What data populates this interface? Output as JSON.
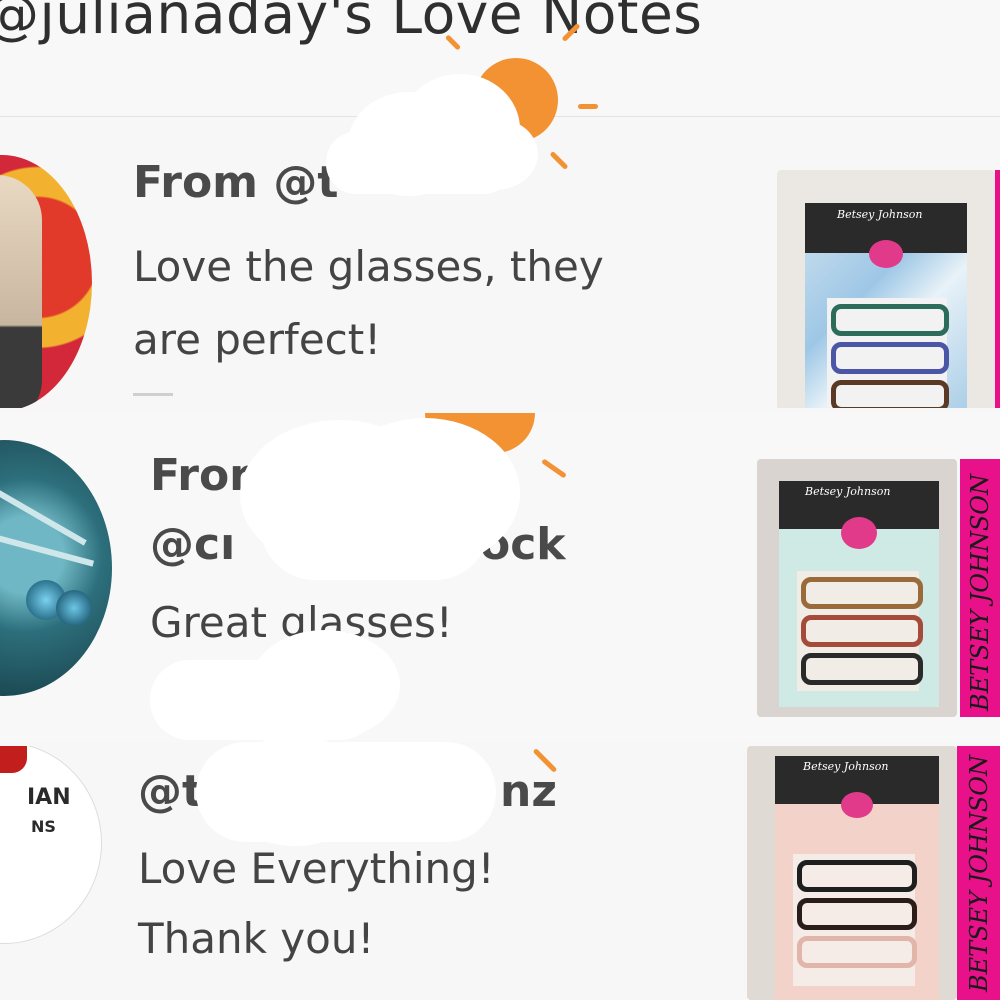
{
  "header": {
    "title": "@julianaday's Love Notes"
  },
  "notes": [
    {
      "from_line": "From @t",
      "message_line1": "Love the glasses, they",
      "message_line2": "are perfect!",
      "product_brand": "Betsey Johnson",
      "avatar": "woman-with-flowers-avatar"
    },
    {
      "from_line1": "Fror",
      "from_line2_start": "@cı",
      "from_line2_end": "ock",
      "message_line1": "Great glasses!",
      "product_brand": "Betsey Johnson",
      "side_label": "BETSEY JOHNSON",
      "avatar": "dragonfly-avatar"
    },
    {
      "from_start": "@t",
      "from_end": "nz",
      "message_line1": "Love Everything!",
      "message_line2": "Thank you!",
      "avatar_text_line1": "IAN",
      "avatar_text_line2": "NS",
      "product_brand": "Betsey Johnson",
      "side_label": "BETSEY JOHNSON"
    }
  ],
  "colors": {
    "sun": "#f39233",
    "brand_pink": "#e8118a",
    "background": "#f7f7f7"
  }
}
